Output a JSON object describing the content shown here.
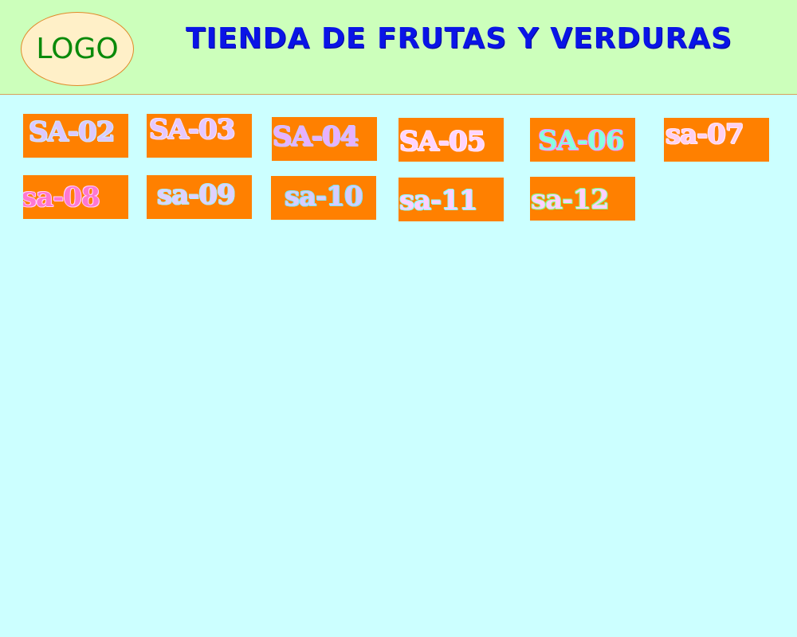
{
  "header": {
    "logo_text": "LOGO",
    "title": "TIENDA DE FRUTAS Y VERDURAS"
  },
  "items": [
    {
      "label": "SA-02",
      "fill": "#dcc8ff",
      "stroke": "#d0e8ff"
    },
    {
      "label": "SA-03",
      "fill": "#e6c8ff",
      "stroke": "#f4e0ff"
    },
    {
      "label": "SA-04",
      "fill": "#e8b0ff",
      "stroke": "#c8c8ff"
    },
    {
      "label": "SA-05",
      "fill": "#ffd4ff",
      "stroke": "#ffe8ff"
    },
    {
      "label": "SA-06",
      "fill": "#88ffe0",
      "stroke": "#ff88ff"
    },
    {
      "label": "sa-07",
      "fill": "#ffd0f0",
      "stroke": "#ffe8f8"
    },
    {
      "label": "sa-08",
      "fill": "#ff78d0",
      "stroke": "#ffd0ff"
    },
    {
      "label": "sa-09",
      "fill": "#e0d0ff",
      "stroke": "#a8f0ff"
    },
    {
      "label": "sa-10",
      "fill": "#d8ccff",
      "stroke": "#7ee8ff"
    },
    {
      "label": "sa-11",
      "fill": "#ffd0ff",
      "stroke": "#88ffff"
    },
    {
      "label": "sa-12",
      "fill": "#ffd0ff",
      "stroke": "#88ff88"
    }
  ]
}
